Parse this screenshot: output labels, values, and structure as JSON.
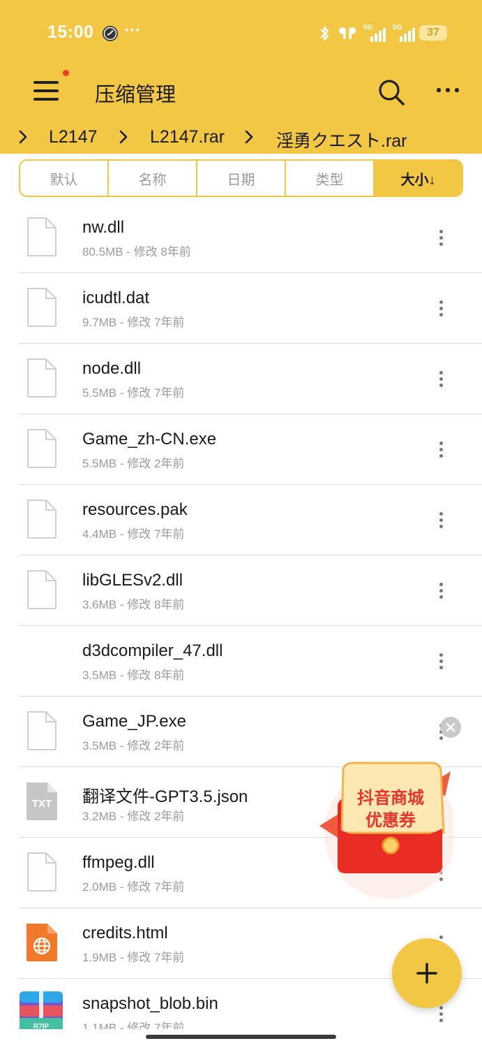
{
  "status_bar": {
    "time": "15:00",
    "dots": "···",
    "network_1": "5G",
    "network_2": "5G",
    "battery": "37"
  },
  "app_bar": {
    "title": "压缩管理",
    "menu_icon": "hamburger-menu-icon",
    "search_icon": "search-icon",
    "more_icon": "more-vert-icon",
    "accent": "#f2c744",
    "badge_color": "#e8402c"
  },
  "breadcrumb": [
    "L2147",
    "L2147.rar",
    "淫勇クエスト.rar"
  ],
  "sort_tabs": [
    {
      "label": "默认",
      "active": false
    },
    {
      "label": "名称",
      "active": false
    },
    {
      "label": "日期",
      "active": false
    },
    {
      "label": "类型",
      "active": false
    },
    {
      "label": "大小↓",
      "active": true
    }
  ],
  "files": [
    {
      "name": "nw.dll",
      "meta": "80.5MB - 修改 8年前",
      "icon": "file-icon"
    },
    {
      "name": "icudtl.dat",
      "meta": "9.7MB - 修改 7年前",
      "icon": "file-icon"
    },
    {
      "name": "node.dll",
      "meta": "5.5MB - 修改 7年前",
      "icon": "file-icon"
    },
    {
      "name": "Game_zh-CN.exe",
      "meta": "5.5MB - 修改 2年前",
      "icon": "file-icon"
    },
    {
      "name": "resources.pak",
      "meta": "4.4MB - 修改 7年前",
      "icon": "file-icon"
    },
    {
      "name": "libGLESv2.dll",
      "meta": "3.6MB - 修改 8年前",
      "icon": "file-icon"
    },
    {
      "name": "d3dcompiler_47.dll",
      "meta": "3.5MB - 修改 8年前",
      "icon": "none"
    },
    {
      "name": "Game_JP.exe",
      "meta": "3.5MB - 修改 2年前",
      "icon": "file-icon"
    },
    {
      "name": "翻译文件-GPT3.5.json",
      "meta": "3.2MB - 修改 2年前",
      "icon": "txt-file-icon",
      "icon_label": "TXT"
    },
    {
      "name": "ffmpeg.dll",
      "meta": "2.0MB - 修改 7年前",
      "icon": "file-icon"
    },
    {
      "name": "credits.html",
      "meta": "1.9MB - 修改 7年前",
      "icon": "html-globe-icon"
    },
    {
      "name": "snapshot_blob.bin",
      "meta": "1.1MB - 修改 7年前",
      "icon": "archive-file-icon",
      "icon_label": "R7IP"
    }
  ],
  "coupon": {
    "line1": "抖音商城",
    "line2": "优惠券",
    "icon": "red-envelope-coupon-icon"
  },
  "fab": {
    "icon": "plus-icon"
  }
}
